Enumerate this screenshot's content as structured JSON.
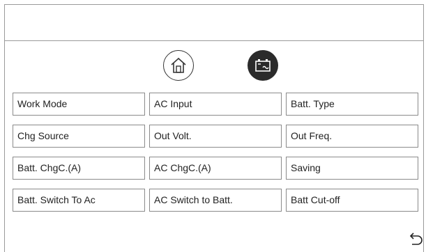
{
  "nav": {
    "home_icon": "home-icon",
    "battery_icon": "battery-icon"
  },
  "settings": [
    [
      "Work Mode",
      "AC Input",
      "Batt. Type"
    ],
    [
      "Chg Source",
      "Out Volt.",
      "Out Freq."
    ],
    [
      "Batt. ChgC.(A)",
      "AC ChgC.(A)",
      "Saving"
    ],
    [
      "Batt. Switch To Ac",
      "AC Switch to Batt.",
      "Batt Cut-off"
    ]
  ],
  "footer": {
    "back_icon": "back-arrow-icon"
  },
  "colors": {
    "border": "#9a9a9a",
    "active_icon_bg": "#2b2b2b"
  }
}
